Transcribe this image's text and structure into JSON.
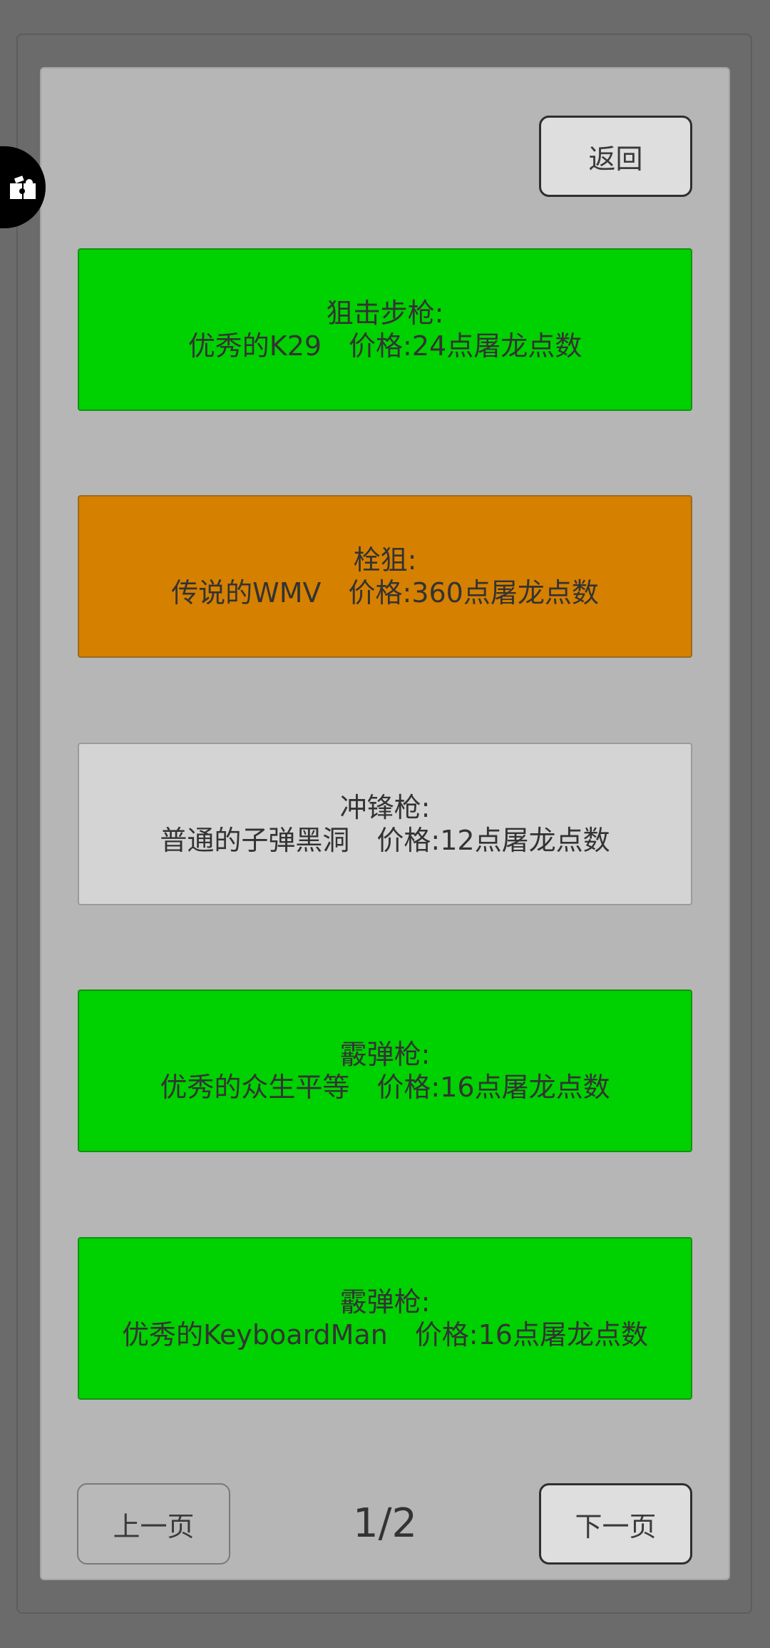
{
  "header": {
    "back_label": "返回"
  },
  "items": [
    {
      "category": "狙击步枪:",
      "detail": "优秀的K29　价格:24点屠龙点数",
      "color": "#00d100",
      "border": "#129112"
    },
    {
      "category": "栓狙:",
      "detail": "传说的WMV　价格:360点屠龙点数",
      "color": "#d68000",
      "border": "#9b6a1f"
    },
    {
      "category": "冲锋枪:",
      "detail": "普通的子弹黑洞　价格:12点屠龙点数",
      "color": "#d4d4d4",
      "border": "#9a9a9a"
    },
    {
      "category": "霰弹枪:",
      "detail": "优秀的众生平等　价格:16点屠龙点数",
      "color": "#00d100",
      "border": "#129112"
    },
    {
      "category": "霰弹枪:",
      "detail": "优秀的KeyboardMan　价格:16点屠龙点数",
      "color": "#00d100",
      "border": "#129112"
    }
  ],
  "pagination": {
    "prev_label": "上一页",
    "page_indicator": "1/2",
    "next_label": "下一页"
  },
  "floating_tool": {
    "icon": "puzzle-piece-icon"
  }
}
